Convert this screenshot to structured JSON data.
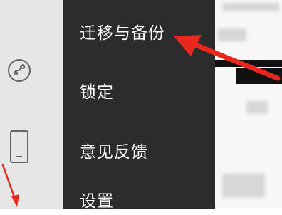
{
  "sidebar": {
    "mini_program_icon": "link-icon",
    "phone_icon": "phone-icon"
  },
  "menu": {
    "items": [
      {
        "label": "迁移与备份"
      },
      {
        "label": "锁定"
      },
      {
        "label": "意见反馈"
      },
      {
        "label": "设置"
      }
    ]
  },
  "colors": {
    "menu_bg": "#2c2c2c",
    "menu_text": "#ffffff",
    "rail_bg": "#e6e6e6",
    "annotation_red": "#e8281f"
  }
}
